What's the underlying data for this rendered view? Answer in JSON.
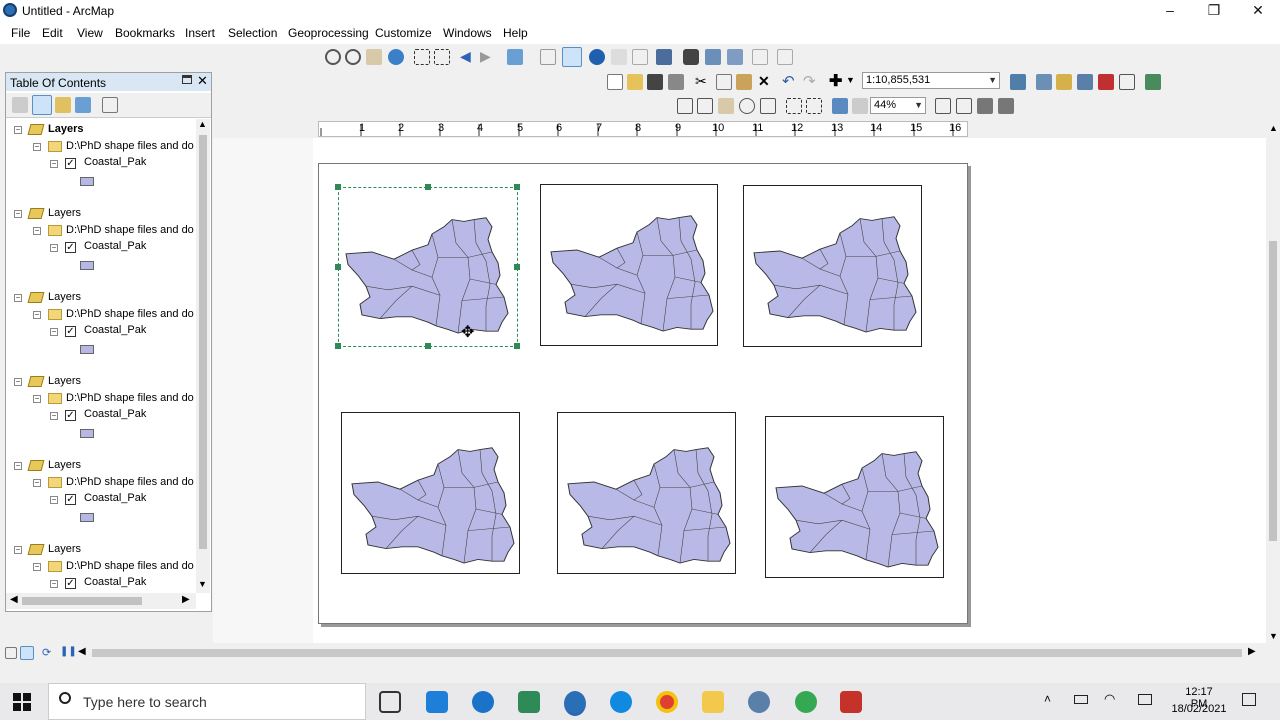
{
  "window": {
    "title": "Untitled - ArcMap",
    "minimize": "–",
    "restore": "❐",
    "close": "✕"
  },
  "menu": [
    "File",
    "Edit",
    "View",
    "Bookmarks",
    "Insert",
    "Selection",
    "Geoprocessing",
    "Customize",
    "Windows",
    "Help"
  ],
  "toolbar": {
    "scale": "1:10,855,531",
    "zoom": "44%"
  },
  "toc": {
    "title": "Table Of Contents",
    "groups": [
      {
        "label": "Layers",
        "folder": "D:\\PhD shape files and do",
        "layer": "Coastal_Pak"
      },
      {
        "label": "Layers",
        "folder": "D:\\PhD shape files and do",
        "layer": "Coastal_Pak"
      },
      {
        "label": "Layers",
        "folder": "D:\\PhD shape files and do",
        "layer": "Coastal_Pak"
      },
      {
        "label": "Layers",
        "folder": "D:\\PhD shape files and do",
        "layer": "Coastal_Pak"
      },
      {
        "label": "Layers",
        "folder": "D:\\PhD shape files and do",
        "layer": "Coastal_Pak"
      },
      {
        "label": "Layers",
        "folder": "D:\\PhD shape files and do",
        "layer": "Coastal_Pak"
      }
    ]
  },
  "ruler": [
    "1",
    "2",
    "3",
    "4",
    "5",
    "6",
    "7",
    "8",
    "9",
    "10",
    "11",
    "12",
    "13",
    "14",
    "15",
    "16"
  ],
  "colors": {
    "map_fill": "#b9b9e8",
    "map_stroke": "#333333",
    "selection": "#2e8b57"
  },
  "taskbar": {
    "search_placeholder": "Type here to search",
    "time": "12:17 PM",
    "date": "18/02/2021"
  }
}
